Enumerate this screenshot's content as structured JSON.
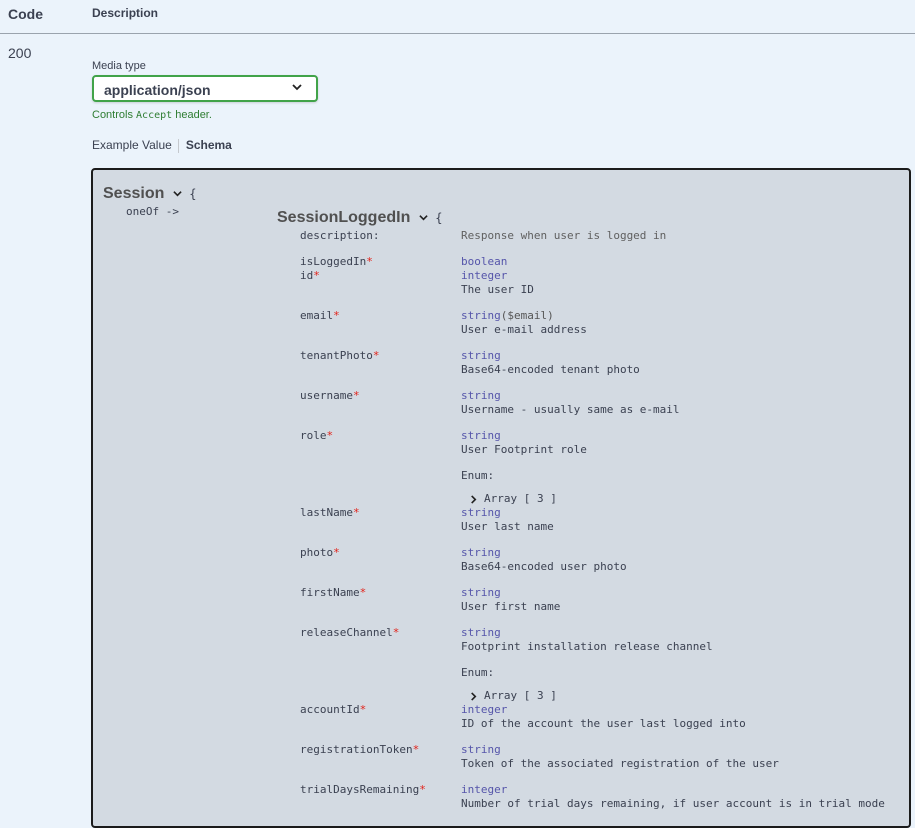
{
  "header": {
    "code_label": "Code",
    "description_label": "Description"
  },
  "response": {
    "status": "200"
  },
  "media_type": {
    "label": "Media type",
    "selected": "application/json",
    "controls_prefix": "Controls",
    "controls_code": "Accept",
    "controls_suffix": "header."
  },
  "tabs": {
    "example": "Example Value",
    "schema": "Schema"
  },
  "schema": {
    "root_name": "Session",
    "open_brace": "{",
    "one_of": "oneOf ->",
    "model_name": "SessionLoggedIn",
    "model_description_key": "description:",
    "model_description": "Response when user is logged in",
    "enum_label": "Enum:",
    "array_label": "Array [ 3 ]",
    "properties": [
      {
        "name": "isLoggedIn",
        "req": "*",
        "type": "boolean",
        "format": "",
        "desc": ""
      },
      {
        "name": "id",
        "req": "*",
        "type": "integer",
        "format": "",
        "desc": "The user ID"
      },
      {
        "name": "email",
        "req": "*",
        "type": "string",
        "format": "($email)",
        "desc": "User e-mail address"
      },
      {
        "name": "tenantPhoto",
        "req": "*",
        "type": "string",
        "format": "",
        "desc": "Base64-encoded tenant photo"
      },
      {
        "name": "username",
        "req": "*",
        "type": "string",
        "format": "",
        "desc": "Username - usually same as e-mail"
      },
      {
        "name": "role",
        "req": "*",
        "type": "string",
        "format": "",
        "desc": "User Footprint role"
      },
      {
        "name": "lastName",
        "req": "*",
        "type": "string",
        "format": "",
        "desc": "User last name"
      },
      {
        "name": "photo",
        "req": "*",
        "type": "string",
        "format": "",
        "desc": "Base64-encoded user photo"
      },
      {
        "name": "firstName",
        "req": "*",
        "type": "string",
        "format": "",
        "desc": "User first name"
      },
      {
        "name": "releaseChannel",
        "req": "*",
        "type": "string",
        "format": "",
        "desc": "Footprint installation release channel"
      },
      {
        "name": "accountId",
        "req": "*",
        "type": "integer",
        "format": "",
        "desc": "ID of the account the user last logged into"
      },
      {
        "name": "registrationToken",
        "req": "*",
        "type": "string",
        "format": "",
        "desc": "Token of the associated registration of the user"
      },
      {
        "name": "trialDaysRemaining",
        "req": "*",
        "type": "integer",
        "format": "",
        "desc": "Number of trial days remaining, if user account is in trial mode"
      }
    ]
  }
}
